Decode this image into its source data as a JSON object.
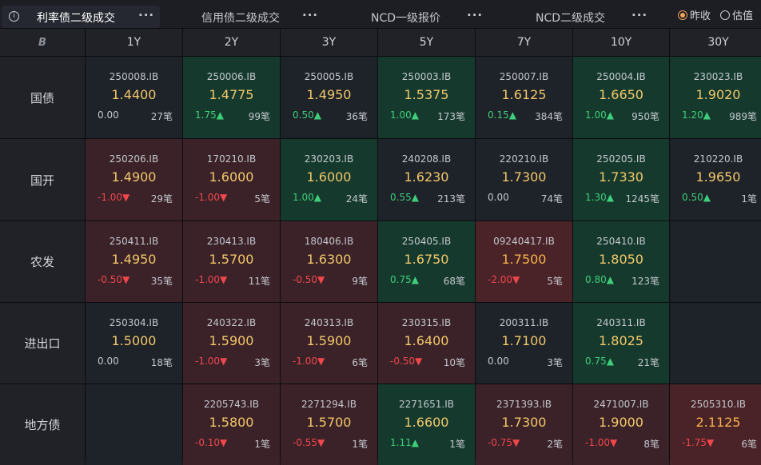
{
  "tabs": [
    {
      "label": "利率债二级成交",
      "active": true
    },
    {
      "label": "信用债二级成交",
      "active": false
    },
    {
      "label": "NCD一级报价",
      "active": false
    },
    {
      "label": "NCD二级成交",
      "active": false
    }
  ],
  "more_glyph": "···",
  "info_glyph": "i",
  "radio": [
    {
      "label": "昨收",
      "checked": true
    },
    {
      "label": "估值",
      "checked": false
    }
  ],
  "corner_logo": "B",
  "tenors": [
    "1Y",
    "2Y",
    "3Y",
    "5Y",
    "7Y",
    "10Y",
    "30Y"
  ],
  "rows": [
    {
      "name": "国债",
      "cells": [
        {
          "code": "250008.IB",
          "yield": "1.4400",
          "change": "0.00",
          "dir": "flat",
          "count": "27笔",
          "tone": "neutral"
        },
        {
          "code": "250006.IB",
          "yield": "1.4775",
          "change": "1.75▲",
          "dir": "up",
          "count": "99笔",
          "tone": "green"
        },
        {
          "code": "250005.IB",
          "yield": "1.4950",
          "change": "0.50▲",
          "dir": "up",
          "count": "36笔",
          "tone": "neutral"
        },
        {
          "code": "250003.IB",
          "yield": "1.5375",
          "change": "1.00▲",
          "dir": "up",
          "count": "173笔",
          "tone": "green"
        },
        {
          "code": "250007.IB",
          "yield": "1.6125",
          "change": "0.15▲",
          "dir": "up",
          "count": "384笔",
          "tone": "neutral"
        },
        {
          "code": "250004.IB",
          "yield": "1.6650",
          "change": "1.00▲",
          "dir": "up",
          "count": "950笔",
          "tone": "green"
        },
        {
          "code": "230023.IB",
          "yield": "1.9020",
          "change": "1.20▲",
          "dir": "up",
          "count": "989笔",
          "tone": "green"
        }
      ]
    },
    {
      "name": "国开",
      "cells": [
        {
          "code": "250206.IB",
          "yield": "1.4900",
          "change": "-1.00▼",
          "dir": "down",
          "count": "29笔",
          "tone": "red"
        },
        {
          "code": "170210.IB",
          "yield": "1.6000",
          "change": "-1.00▼",
          "dir": "down",
          "count": "5笔",
          "tone": "red"
        },
        {
          "code": "230203.IB",
          "yield": "1.6000",
          "change": "1.00▲",
          "dir": "up",
          "count": "24笔",
          "tone": "green"
        },
        {
          "code": "240208.IB",
          "yield": "1.6230",
          "change": "0.55▲",
          "dir": "up",
          "count": "213笔",
          "tone": "neutral"
        },
        {
          "code": "220210.IB",
          "yield": "1.7300",
          "change": "0.00",
          "dir": "flat",
          "count": "74笔",
          "tone": "neutral"
        },
        {
          "code": "250205.IB",
          "yield": "1.7330",
          "change": "1.30▲",
          "dir": "up",
          "count": "1245笔",
          "tone": "green"
        },
        {
          "code": "210220.IB",
          "yield": "1.9650",
          "change": "0.50▲",
          "dir": "up",
          "count": "1笔",
          "tone": "neutral"
        }
      ]
    },
    {
      "name": "农发",
      "cells": [
        {
          "code": "250411.IB",
          "yield": "1.4950",
          "change": "-0.50▼",
          "dir": "down",
          "count": "35笔",
          "tone": "red"
        },
        {
          "code": "230413.IB",
          "yield": "1.5700",
          "change": "-1.00▼",
          "dir": "down",
          "count": "11笔",
          "tone": "red"
        },
        {
          "code": "180406.IB",
          "yield": "1.6300",
          "change": "-0.50▼",
          "dir": "down",
          "count": "9笔",
          "tone": "red"
        },
        {
          "code": "250405.IB",
          "yield": "1.6750",
          "change": "0.75▲",
          "dir": "up",
          "count": "68笔",
          "tone": "green"
        },
        {
          "code": "09240417.IB",
          "yield": "1.7500",
          "change": "-2.00▼",
          "dir": "down",
          "count": "5笔",
          "tone": "redstrong"
        },
        {
          "code": "250410.IB",
          "yield": "1.8050",
          "change": "0.80▲",
          "dir": "up",
          "count": "123笔",
          "tone": "green"
        },
        null
      ]
    },
    {
      "name": "进出口",
      "cells": [
        {
          "code": "250304.IB",
          "yield": "1.5000",
          "change": "0.00",
          "dir": "flat",
          "count": "18笔",
          "tone": "neutral"
        },
        {
          "code": "240322.IB",
          "yield": "1.5900",
          "change": "-1.00▼",
          "dir": "down",
          "count": "3笔",
          "tone": "red"
        },
        {
          "code": "240313.IB",
          "yield": "1.5900",
          "change": "-1.00▼",
          "dir": "down",
          "count": "6笔",
          "tone": "red"
        },
        {
          "code": "230315.IB",
          "yield": "1.6400",
          "change": "-0.50▼",
          "dir": "down",
          "count": "10笔",
          "tone": "red"
        },
        {
          "code": "200311.IB",
          "yield": "1.7100",
          "change": "0.00",
          "dir": "flat",
          "count": "3笔",
          "tone": "neutral"
        },
        {
          "code": "240311.IB",
          "yield": "1.8025",
          "change": "0.75▲",
          "dir": "up",
          "count": "21笔",
          "tone": "green"
        },
        null
      ]
    },
    {
      "name": "地方债",
      "cells": [
        null,
        {
          "code": "2205743.IB",
          "yield": "1.5800",
          "change": "-0.10▼",
          "dir": "down",
          "count": "1笔",
          "tone": "red"
        },
        {
          "code": "2271294.IB",
          "yield": "1.5700",
          "change": "-0.55▼",
          "dir": "down",
          "count": "1笔",
          "tone": "red"
        },
        {
          "code": "2271651.IB",
          "yield": "1.6600",
          "change": "1.11▲",
          "dir": "up",
          "count": "1笔",
          "tone": "green"
        },
        {
          "code": "2371393.IB",
          "yield": "1.7300",
          "change": "-0.75▼",
          "dir": "down",
          "count": "2笔",
          "tone": "red"
        },
        {
          "code": "2471007.IB",
          "yield": "1.9000",
          "change": "-1.00▼",
          "dir": "down",
          "count": "8笔",
          "tone": "red"
        },
        {
          "code": "2505310.IB",
          "yield": "2.1125",
          "change": "-1.75▼",
          "dir": "down",
          "count": "6笔",
          "tone": "redstrong"
        }
      ]
    }
  ]
}
